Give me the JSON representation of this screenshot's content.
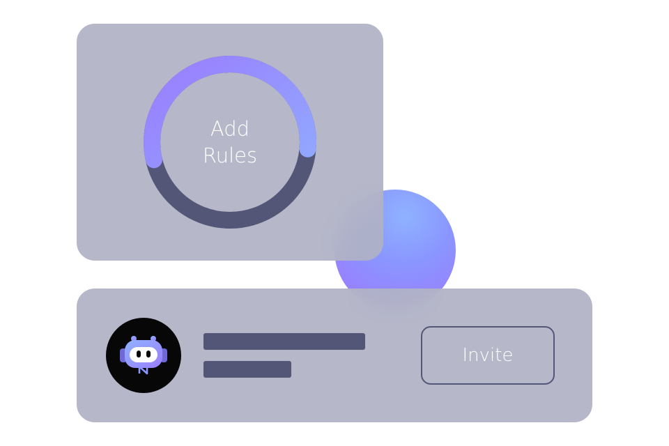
{
  "rules_card": {
    "progress": 0.55,
    "label_line1": "Add",
    "label_line2": "Rules",
    "colors": {
      "track": "#545678",
      "progress_start": "#8fb2ff",
      "progress_end": "#9a7dff"
    }
  },
  "invite_card": {
    "avatar_icon": "robot-icon",
    "invite_label": "Invite",
    "colors": {
      "avatar_bg": "#070708",
      "placeholder": "#545678",
      "button_border": "#545678"
    }
  },
  "decoration": {
    "orb_icon": "gradient-orb",
    "orb_colors": [
      "#8fb2ff",
      "#9a7dff"
    ]
  }
}
